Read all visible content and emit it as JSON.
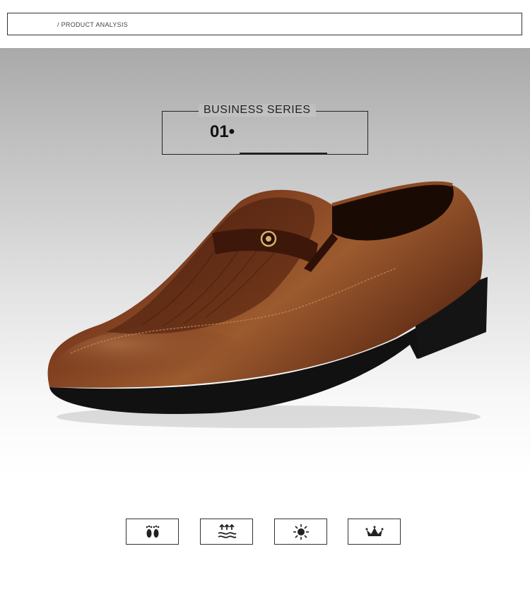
{
  "header": {
    "label": "/ PRODUCT ANALYSIS"
  },
  "series": {
    "title": "BUSINESS SERIES",
    "number": "01•"
  },
  "product": {
    "image": "brown-leather-slip-on-loafer-shoe",
    "color": "#6b3218"
  },
  "features": [
    {
      "icon": "footprints-icon"
    },
    {
      "icon": "breathable-icon"
    },
    {
      "icon": "sun-icon"
    },
    {
      "icon": "crown-icon"
    }
  ]
}
